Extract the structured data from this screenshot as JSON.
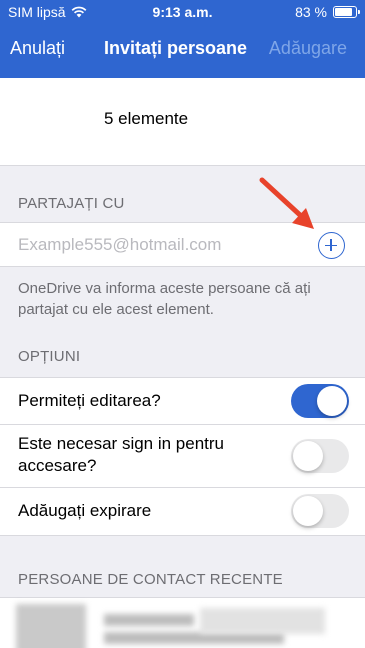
{
  "status_bar": {
    "carrier": "SIM lipsă",
    "time": "9:13 a.m.",
    "battery_percent": "83 %",
    "battery_level": 0.83
  },
  "nav": {
    "cancel_label": "Anulați",
    "title": "Invitați persoane",
    "add_label": "Adăugare"
  },
  "items": {
    "count_label": "5 elemente"
  },
  "share": {
    "header": "PARTAJAȚI CU",
    "email_placeholder": "Example555@hotmail.com",
    "info": "OneDrive va informa aceste persoane că ați partajat cu ele acest element."
  },
  "options": {
    "header": "OPȚIUNI",
    "rows": [
      {
        "label": "Permiteți editarea?",
        "enabled": true
      },
      {
        "label": "Este necesar sign in pentru accesare?",
        "enabled": false
      },
      {
        "label": "Adăugați expirare",
        "enabled": false
      }
    ]
  },
  "recent": {
    "header": "PERSOANE DE CONTACT RECENTE"
  },
  "colors": {
    "accent": "#2f66d0",
    "annotation_arrow": "#e8432b"
  }
}
